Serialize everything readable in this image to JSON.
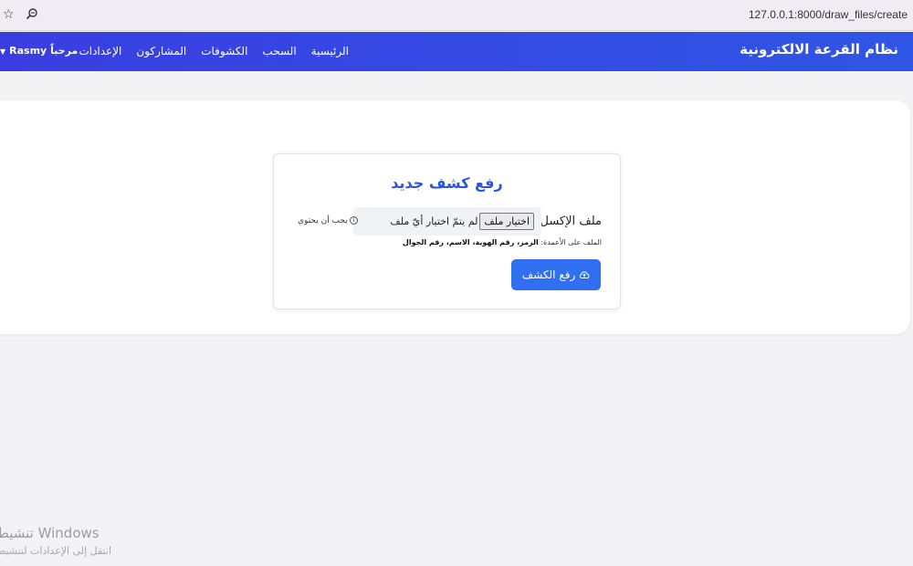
{
  "browser": {
    "url": "127.0.0.1:8000/draw_files/create"
  },
  "navbar": {
    "brand": "نظام القرعة الالكترونية",
    "links": [
      "الرئيسية",
      "السحب",
      "الكشوفات",
      "المشاركون",
      "الإعدادات"
    ],
    "user_greeting": "مرحباً Rasmy",
    "color_start": "#3a3ee0",
    "color_end": "#2f55e6"
  },
  "form": {
    "title": "رفع كشف جديد",
    "file_label": "ملف الإكسل",
    "file_button": "اختيار ملف",
    "file_status": "لم يتمّ اختيار أيّ ملف",
    "hint_lead": "يجب أن يحتوي",
    "hint_prefix": "الملف على الأعمدة:",
    "hint_columns": "الرمز، رقم الهوية، الاسم، رقم الجوال",
    "submit_label": "رفع الكشف",
    "accent_color": "#2f6ff0"
  },
  "watermark": {
    "title": "تنشيط Windows",
    "subtitle": "انتقل إلى الإعدادات لتنشيط"
  }
}
